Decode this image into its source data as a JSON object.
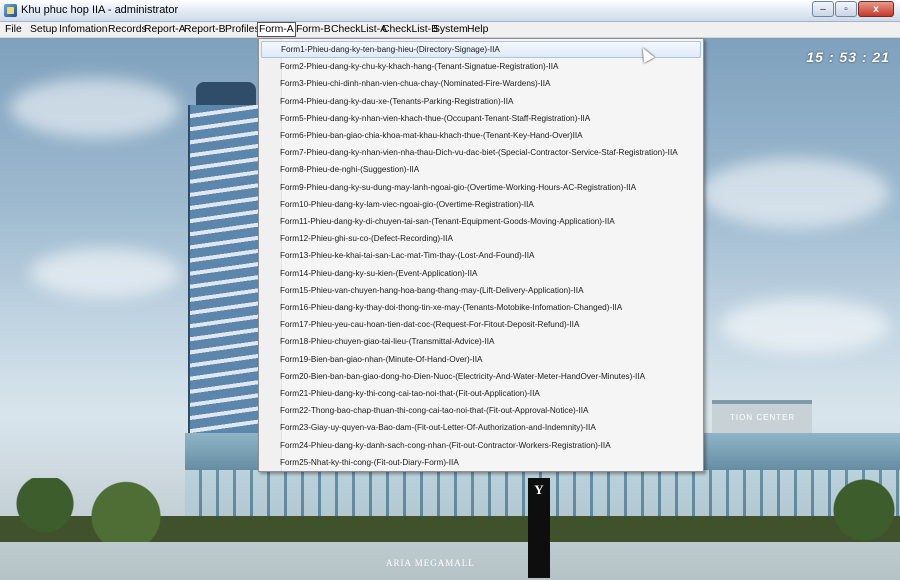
{
  "window": {
    "title": "Khu phuc hop IIA - administrator",
    "buttons": [
      "–",
      "▫",
      "x"
    ]
  },
  "menubar": {
    "items": [
      "File",
      "Setup",
      "Infomation",
      "Records",
      "Report-A",
      "Report-B",
      "Profiles",
      "Form-A",
      "Form-B",
      "CheckList-A",
      "CheckList-B",
      "System",
      "Help"
    ],
    "active": "Form-A"
  },
  "clock": "15 : 53 : 21",
  "background": {
    "sign_right": "TION CENTER",
    "mall_name": "ARIA MEGAMALL"
  },
  "dropdown": {
    "highlighted_index": 0,
    "items": [
      "Form1-Phieu-dang-ky-ten-bang-hieu-(Directory-Signage)-IIA",
      "Form2-Phieu-dang-ky-chu-ky-khach-hang-(Tenant-Signatue-Registration)-IIA",
      "Form3-Phieu-chi-dinh-nhan-vien-chua-chay-(Nominated-Fire-Wardens)-IIA",
      "Form4-Phieu-dang-ky-dau-xe-(Tenants-Parking-Registration)-IIA",
      "Form5-Phieu-dang-ky-nhan-vien-khach-thue-(Occupant-Tenant-Staff-Registration)-IIA",
      "Form6-Phieu-ban-giao-chia-khoa-mat-khau-khach-thue-(Tenant-Key-Hand-Over)IIA",
      "Form7-Phieu-dang-ky-nhan-vien-nha-thau-Dich-vu-dac-biet-(Special-Contractor-Service-Staf-Registration)-IIA",
      "Form8-Phieu-de-nghi-(Suggestion)-IIA",
      "Form9-Phieu-dang-ky-su-dung-may-lanh-ngoai-gio-(Overtime-Working-Hours-AC-Registration)-IIA",
      "Form10-Phieu-dang-ky-lam-viec-ngoai-gio-(Overtime-Registration)-IIA",
      "Form11-Phieu-dang-ky-di-chuyen-tai-san-(Tenant-Equipment-Goods-Moving-Application)-IIA",
      "Form12-Phieu-ghi-su-co-(Defect-Recording)-IIA",
      "Form13-Phieu-ke-khai-tai-san-Lac-mat-Tim-thay-(Lost-And-Found)-IIA",
      "Form14-Phieu-dang-ky-su-kien-(Event-Application)-IIA",
      "Form15-Phieu-van-chuyen-hang-hoa-bang-thang-may-(Lift-Delivery-Application)-IIA",
      "Form16-Phieu-dang-ky-thay-doi-thong-tin-xe-may-(Tenants-Motobike-Infomation-Changed)-IIA",
      "Form17-Phieu-yeu-cau-hoan-tien-dat-coc-(Request-For-Fitout-Deposit-Refund)-IIA",
      "Form18-Phieu-chuyen-giao-tai-lieu-(Transmittal-Advice)-IIA",
      "Form19-Bien-ban-giao-nhan-(Minute-Of-Hand-Over)-IIA",
      "Form20-Bien-ban-ban-giao-dong-ho-Dien-Nuoc-(Electricity-And-Water-Meter-HandOver-Minutes)-IIA",
      "Form21-Phieu-dang-ky-thi-cong-cai-tao-noi-that-(Fit-out-Application)-IIA",
      "Form22-Thong-bao-chap-thuan-thi-cong-cai-tao-noi-that-(Fit-out-Approval-Notice)-IIA",
      "Form23-Giay-uy-quyen-va-Bao-dam-(Fit-out-Letter-Of-Authorization-and-Indemnity)-IIA",
      "Form24-Phieu-dang-ky-danh-sach-cong-nhan-(Fit-out-Contractor-Workers-Registration)-IIA",
      "Form25-Nhat-ky-thi-cong-(Fit-out-Diary-Form)-IIA"
    ]
  }
}
